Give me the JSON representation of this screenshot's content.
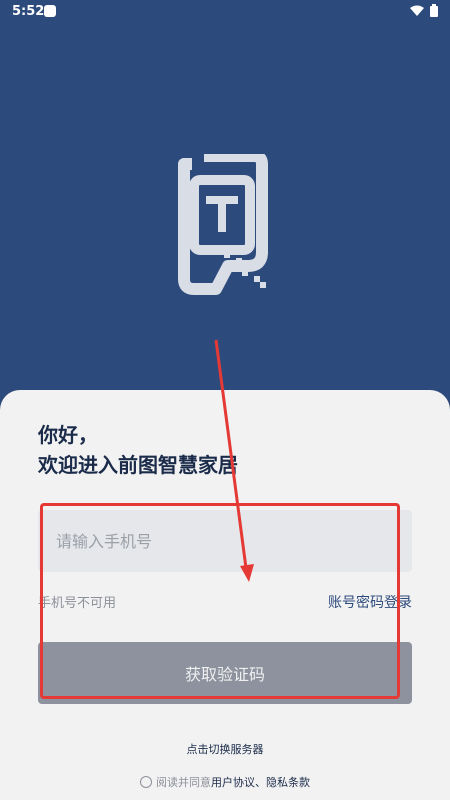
{
  "status_bar": {
    "time": "5:52"
  },
  "login": {
    "greeting_line1": "你好，",
    "greeting_line2": "欢迎进入前图智慧家居",
    "phone_placeholder": "请输入手机号",
    "phone_unavailable": "手机号不可用",
    "password_login": "账号密码登录",
    "get_code_button": "获取验证码",
    "switch_server": "点击切换服务器",
    "agreement_prefix": "阅读并同意",
    "user_agreement": "用户协议",
    "separator": "、",
    "privacy_policy": "隐私条款"
  },
  "colors": {
    "brand_blue": "#2d4a7c",
    "annotation_red": "#e53935",
    "disabled_button": "#8d929e"
  }
}
